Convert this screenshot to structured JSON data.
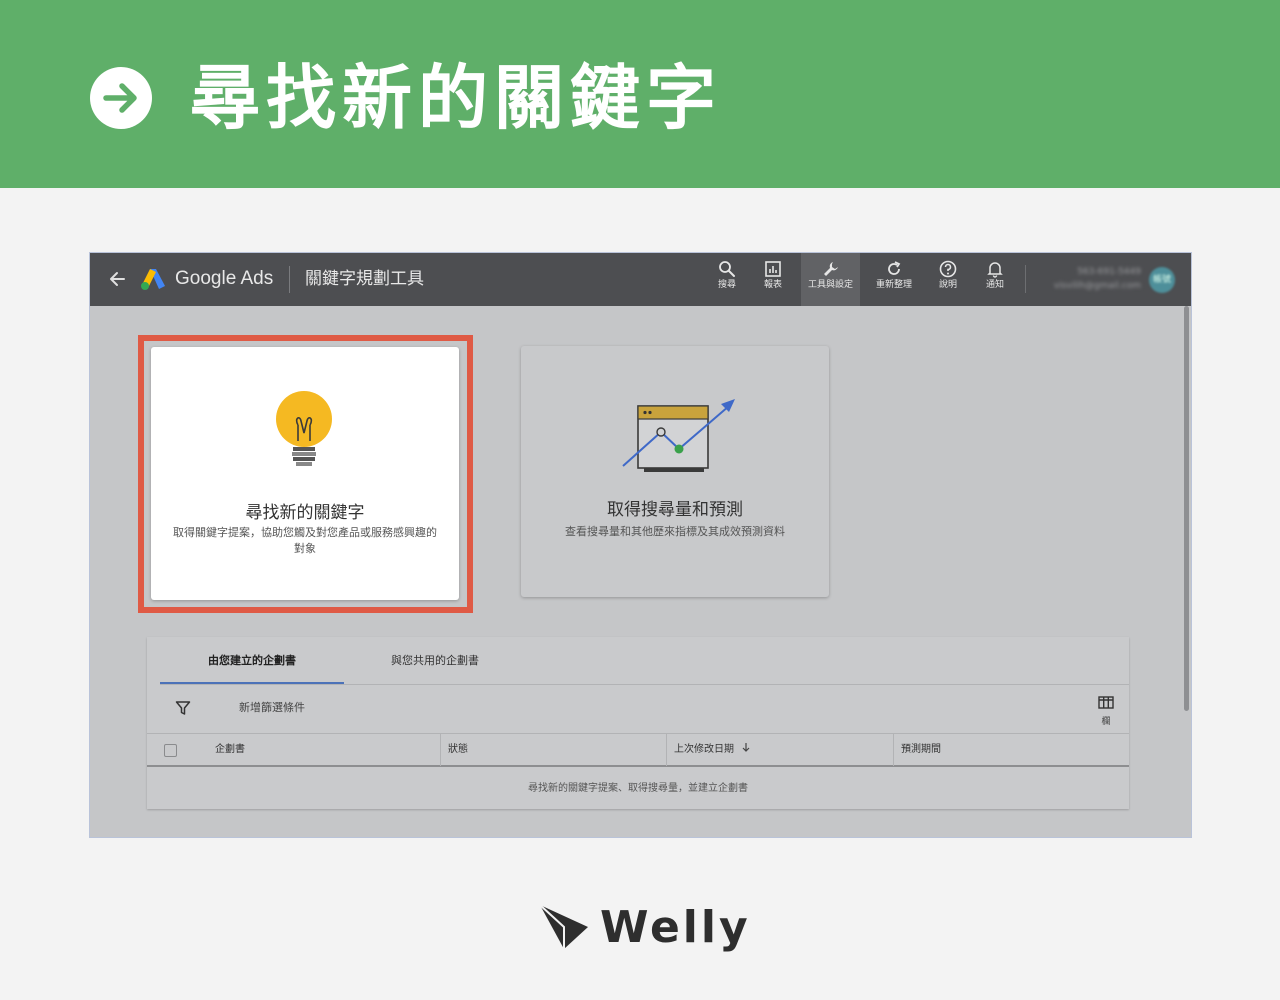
{
  "banner": {
    "title": "尋找新的關鍵字",
    "icon": "arrow-right-circle-icon",
    "background_color": "#5faf69"
  },
  "app": {
    "brand": "Google Ads",
    "tool_title": "關鍵字規劃工具",
    "back_icon": "arrow-back-icon",
    "nav": [
      {
        "label": "搜尋",
        "icon": "search-icon"
      },
      {
        "label": "報表",
        "icon": "report-icon"
      },
      {
        "label": "工具與設定",
        "icon": "wrench-icon",
        "active": true
      },
      {
        "label": "重新整理",
        "icon": "refresh-icon"
      },
      {
        "label": "說明",
        "icon": "help-icon"
      },
      {
        "label": "通知",
        "icon": "bell-icon"
      }
    ],
    "account": {
      "id_line": "563-691-5449",
      "email_line": "visvilih@gmail.com",
      "avatar_text": "帳號"
    }
  },
  "cards": [
    {
      "title": "尋找新的關鍵字",
      "description": "取得關鍵字提案，協助您觸及對您產品或服務感興趣的對象",
      "icon": "lightbulb-icon",
      "highlight_color": "#df5a45"
    },
    {
      "title": "取得搜尋量和預測",
      "description": "查看搜尋量和其他歷來指標及其成效預測資料",
      "icon": "trend-chart-icon"
    }
  ],
  "plans": {
    "tabs": [
      "由您建立的企劃書",
      "與您共用的企劃書"
    ],
    "active_tab": "由您建立的企劃書",
    "filter_label": "新增篩選條件",
    "columns_label": "欄",
    "headers": [
      "企劃書",
      "狀態",
      "上次修改日期",
      "預測期間"
    ],
    "sort_icon": "arrow-down-icon",
    "empty_message": "尋找新的關鍵字提案、取得搜尋量，並建立企劃書"
  },
  "footer": {
    "brand": "Welly"
  }
}
